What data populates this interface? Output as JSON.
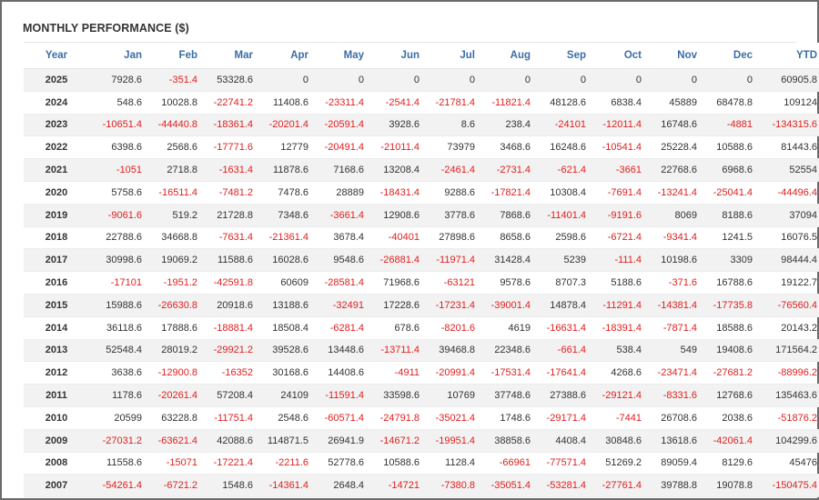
{
  "title": "MONTHLY PERFORMANCE ($)",
  "colors": {
    "header_text": "#3a6ea5",
    "negative": "#e02020",
    "positive": "#333333",
    "stripe": "#f2f2f2"
  },
  "headers": [
    "Year",
    "Jan",
    "Feb",
    "Mar",
    "Apr",
    "May",
    "Jun",
    "Jul",
    "Aug",
    "Sep",
    "Oct",
    "Nov",
    "Dec",
    "YTD"
  ],
  "rows": [
    [
      "2025",
      "7928.6",
      "-351.4",
      "53328.6",
      "0",
      "0",
      "0",
      "0",
      "0",
      "0",
      "0",
      "0",
      "0",
      "60905.8"
    ],
    [
      "2024",
      "548.6",
      "10028.8",
      "-22741.2",
      "11408.6",
      "-23311.4",
      "-2541.4",
      "-21781.4",
      "-11821.4",
      "48128.6",
      "6838.4",
      "45889",
      "68478.8",
      "109124"
    ],
    [
      "2023",
      "-10651.4",
      "-44440.8",
      "-18361.4",
      "-20201.4",
      "-20591.4",
      "3928.6",
      "8.6",
      "238.4",
      "-24101",
      "-12011.4",
      "16748.6",
      "-4881",
      "-134315.6"
    ],
    [
      "2022",
      "6398.6",
      "2568.6",
      "-17771.6",
      "12779",
      "-20491.4",
      "-21011.4",
      "73979",
      "3468.6",
      "16248.6",
      "-10541.4",
      "25228.4",
      "10588.6",
      "81443.6"
    ],
    [
      "2021",
      "-1051",
      "2718.8",
      "-1631.4",
      "11878.6",
      "7168.6",
      "13208.4",
      "-2461.4",
      "-2731.4",
      "-621.4",
      "-3661",
      "22768.6",
      "6968.6",
      "52554"
    ],
    [
      "2020",
      "5758.6",
      "-16511.4",
      "-7481.2",
      "7478.6",
      "28889",
      "-18431.4",
      "9288.6",
      "-17821.4",
      "10308.4",
      "-7691.4",
      "-13241.4",
      "-25041.4",
      "-44496.4"
    ],
    [
      "2019",
      "-9061.6",
      "519.2",
      "21728.8",
      "7348.6",
      "-3661.4",
      "12908.6",
      "3778.6",
      "7868.6",
      "-11401.4",
      "-9191.6",
      "8069",
      "8188.6",
      "37094"
    ],
    [
      "2018",
      "22788.6",
      "34668.8",
      "-7631.4",
      "-21361.4",
      "3678.4",
      "-40401",
      "27898.6",
      "8658.6",
      "2598.6",
      "-6721.4",
      "-9341.4",
      "1241.5",
      "16076.5"
    ],
    [
      "2017",
      "30998.6",
      "19069.2",
      "11588.6",
      "16028.6",
      "9548.6",
      "-26881.4",
      "-11971.4",
      "31428.4",
      "5239",
      "-111.4",
      "10198.6",
      "3309",
      "98444.4"
    ],
    [
      "2016",
      "-17101",
      "-1951.2",
      "-42591.8",
      "60609",
      "-28581.4",
      "71968.6",
      "-63121",
      "9578.6",
      "8707.3",
      "5188.6",
      "-371.6",
      "16788.6",
      "19122.7"
    ],
    [
      "2015",
      "15988.6",
      "-26630.8",
      "20918.6",
      "13188.6",
      "-32491",
      "17228.6",
      "-17231.4",
      "-39001.4",
      "14878.4",
      "-11291.4",
      "-14381.4",
      "-17735.8",
      "-76560.4"
    ],
    [
      "2014",
      "36118.6",
      "17888.6",
      "-18881.4",
      "18508.4",
      "-6281.4",
      "678.6",
      "-8201.6",
      "4619",
      "-16631.4",
      "-18391.4",
      "-7871.4",
      "18588.6",
      "20143.2"
    ],
    [
      "2013",
      "52548.4",
      "28019.2",
      "-29921.2",
      "39528.6",
      "13448.6",
      "-13711.4",
      "39468.8",
      "22348.6",
      "-661.4",
      "538.4",
      "549",
      "19408.6",
      "171564.2"
    ],
    [
      "2012",
      "3638.6",
      "-12900.8",
      "-16352",
      "30168.6",
      "14408.6",
      "-4911",
      "-20991.4",
      "-17531.4",
      "-17641.4",
      "4268.6",
      "-23471.4",
      "-27681.2",
      "-88996.2"
    ],
    [
      "2011",
      "1178.6",
      "-20261.4",
      "57208.4",
      "24109",
      "-11591.4",
      "33598.6",
      "10769",
      "37748.6",
      "27388.6",
      "-29121.4",
      "-8331.6",
      "12768.6",
      "135463.6"
    ],
    [
      "2010",
      "20599",
      "63228.8",
      "-11751.4",
      "2548.6",
      "-60571.4",
      "-24791.8",
      "-35021.4",
      "1748.6",
      "-29171.4",
      "-7441",
      "26708.6",
      "2038.6",
      "-51876.2"
    ],
    [
      "2009",
      "-27031.2",
      "-63621.4",
      "42088.6",
      "114871.5",
      "26941.9",
      "-14671.2",
      "-19951.4",
      "38858.6",
      "4408.4",
      "30848.6",
      "13618.6",
      "-42061.4",
      "104299.6"
    ],
    [
      "2008",
      "11558.6",
      "-15071",
      "-17221.4",
      "-2211.6",
      "52778.6",
      "10588.6",
      "1128.4",
      "-66961",
      "-77571.4",
      "51269.2",
      "89059.4",
      "8129.6",
      "45476"
    ],
    [
      "2007",
      "-54261.4",
      "-6721.2",
      "1548.6",
      "-14361.4",
      "2648.4",
      "-14721",
      "-7380.8",
      "-35051.4",
      "-53281.4",
      "-27761.4",
      "39788.8",
      "19078.8",
      "-150475.4"
    ]
  ]
}
